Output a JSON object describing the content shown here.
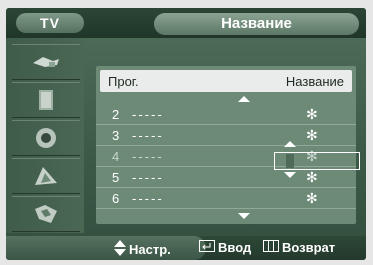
{
  "header": {
    "tv_label": "TV",
    "title": "Название"
  },
  "sidebar": {
    "items": [
      {
        "icon": "picture-icon"
      },
      {
        "icon": "sound-icon"
      },
      {
        "icon": "speaker-icon"
      },
      {
        "icon": "channel-icon"
      },
      {
        "icon": "setup-icon"
      }
    ]
  },
  "table": {
    "col_prog": "Прог.",
    "col_name": "Название",
    "rows": [
      {
        "num": "2",
        "dash": "-----",
        "val": "✻"
      },
      {
        "num": "3",
        "dash": "-----",
        "val": "✻"
      },
      {
        "num": "4",
        "dash": "-----",
        "val": "✻"
      },
      {
        "num": "5",
        "dash": "-----",
        "val": "✻"
      },
      {
        "num": "6",
        "dash": "-----",
        "val": "✻"
      }
    ]
  },
  "footer": {
    "nav_label": "Настр.",
    "enter_label": "Ввод",
    "back_label": "Возврат"
  },
  "colors": {
    "accent": "#6d8a77",
    "background": "#4f6e5a"
  }
}
